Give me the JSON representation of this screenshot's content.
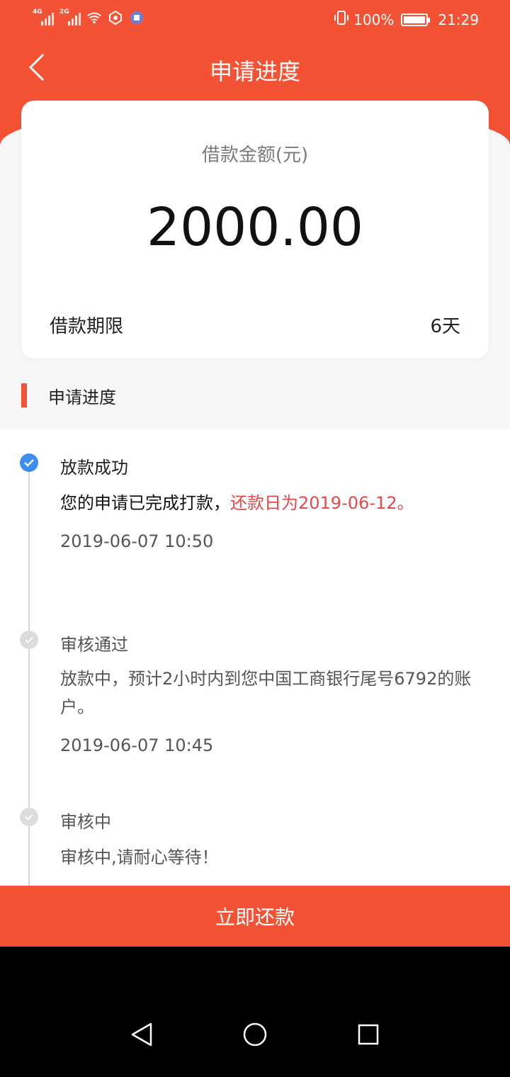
{
  "status_bar": {
    "net1": "4G",
    "net2": "2G",
    "battery_text": "100%",
    "time": "21:29",
    "icons": [
      "signal-icon",
      "signal-icon",
      "wifi-icon",
      "app-notification-icon",
      "app-notification-icon",
      "vibrate-icon",
      "battery-icon"
    ]
  },
  "header": {
    "title": "申请进度",
    "back_icon": "back-chevron-icon"
  },
  "loan_card": {
    "amount_label": "借款金额(元)",
    "amount": "2000.00",
    "term_label": "借款期限",
    "term_value": "6天"
  },
  "section": {
    "title": "申请进度"
  },
  "steps": [
    {
      "title": "放款成功",
      "desc_main": "您的申请已完成打款，",
      "desc_highlight": "还款日为2019-06-12。",
      "time": "2019-06-07 10:50",
      "status": "active"
    },
    {
      "title": "审核通过",
      "desc": "放款中，预计2小时内到您中国工商银行尾号6792的账户。",
      "time": "2019-06-07 10:45",
      "status": "done"
    },
    {
      "title": "审核中",
      "desc": "审核中,请耐心等待！",
      "status": "done"
    }
  ],
  "cta": {
    "label": "立即还款"
  },
  "system_nav": {
    "icons": [
      "nav-back-icon",
      "nav-home-icon",
      "nav-recent-icon"
    ]
  },
  "colors": {
    "brand": "#f45234",
    "active_step": "#3d8ef0",
    "highlight_text": "#e44a4a"
  }
}
